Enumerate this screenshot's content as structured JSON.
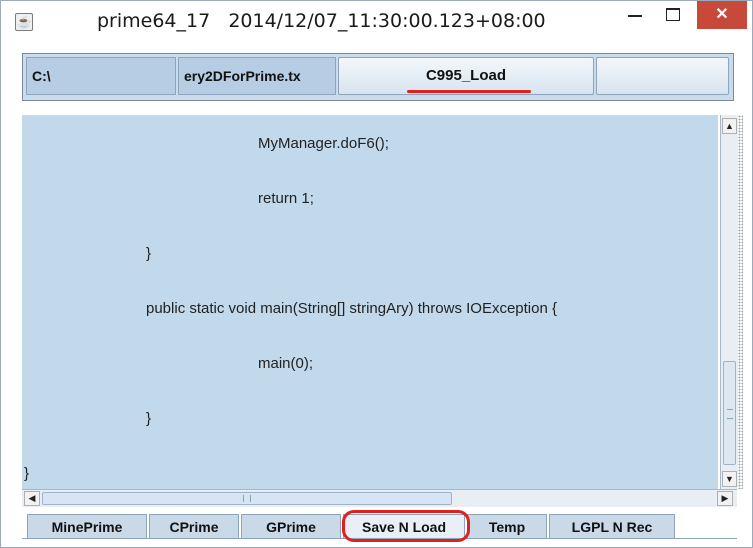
{
  "window": {
    "title": "prime64_17   2014/12/07_11:30:00.123+08:00",
    "app_icon": "java-cup-icon",
    "minimize_icon": "minimize-icon",
    "maximize_icon": "maximize-icon",
    "close_glyph": "✕",
    "close_icon": "close-icon",
    "close_color": "#c7493a"
  },
  "toolbar": {
    "path_value": "C:\\",
    "file_value": "ery2DForPrime.tx",
    "load_button": "C995_Load",
    "extra_button": ""
  },
  "code": {
    "lines": [
      "MyManager.doF6();",
      "return 1;",
      "}",
      "public static void main(String[] stringAry) throws IOException {",
      "main(0);",
      "}",
      "}"
    ]
  },
  "scrollbars": {
    "up_glyph": "▲",
    "down_glyph": "▼",
    "left_glyph": "◀",
    "right_glyph": "▶"
  },
  "tabs": [
    {
      "label": "MinePrime",
      "selected": false
    },
    {
      "label": "CPrime",
      "selected": false
    },
    {
      "label": "GPrime",
      "selected": false
    },
    {
      "label": "Save N Load",
      "selected": true
    },
    {
      "label": "Temp",
      "selected": false
    },
    {
      "label": "LGPL N Rec",
      "selected": false
    }
  ],
  "annotations": {
    "highlight_color": "#e0201c"
  }
}
